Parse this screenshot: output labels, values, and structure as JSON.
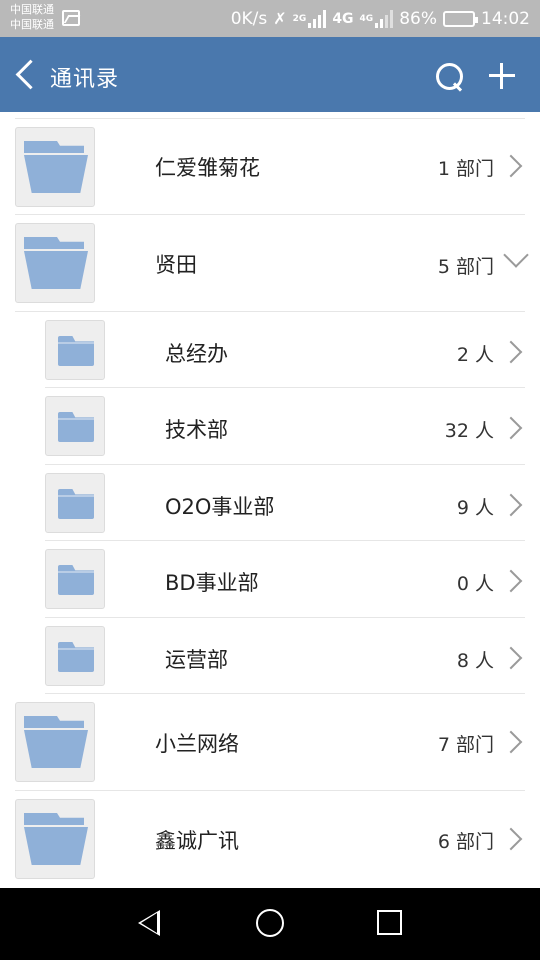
{
  "status_bar": {
    "carrier_1": "中国联通",
    "carrier_2": "中国联通",
    "speed": "0K/s",
    "net_2g": "2G",
    "net_4g": "4G",
    "net_4g_small": "4G",
    "battery": "86%",
    "time": "14:02"
  },
  "header": {
    "title": "通讯录"
  },
  "colors": {
    "header_bg": "#4a78ad",
    "status_bg": "#b9b9b9",
    "folder": "#8fb0d8"
  },
  "list": {
    "companies": [
      {
        "name": "仁爱雏菊花",
        "count": "1 部门",
        "expanded": false
      },
      {
        "name": "贤田",
        "count": "5 部门",
        "expanded": true
      },
      {
        "name": "小兰网络",
        "count": "7 部门",
        "expanded": false
      },
      {
        "name": "鑫诚广讯",
        "count": "6 部门",
        "expanded": false
      }
    ],
    "departments": [
      {
        "name": "总经办",
        "count": "2 人"
      },
      {
        "name": "技术部",
        "count": "32 人"
      },
      {
        "name": "O2O事业部",
        "count": "9 人"
      },
      {
        "name": "BD事业部",
        "count": "0 人"
      },
      {
        "name": "运营部",
        "count": "8 人"
      }
    ]
  }
}
